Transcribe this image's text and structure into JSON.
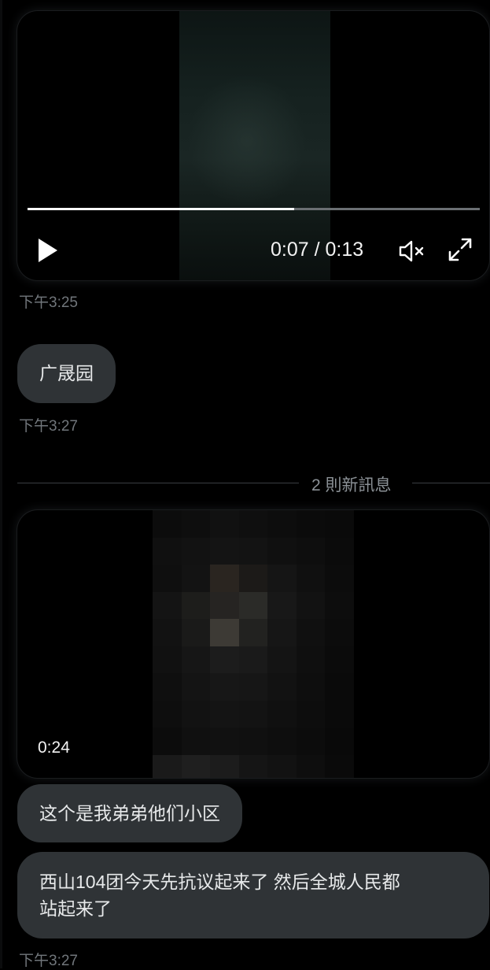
{
  "colors": {
    "background": "#000000",
    "bubble": "#2f3336",
    "text": "#e7e9ea",
    "muted": "#71767b",
    "progress_fill": "#ffffff",
    "progress_track": "#6b6f73"
  },
  "video_1": {
    "progress": 0.59,
    "time_readout": "0:07 / 0:13",
    "icons": [
      "play-icon",
      "volume-muted-icon",
      "fullscreen-icon"
    ]
  },
  "messages": {
    "timestamp_1": "下午3:25",
    "bubble_1": "广晟园",
    "timestamp_2": "下午3:27",
    "new_messages_label": "2 則新訊息",
    "video_2_duration": "0:24",
    "bubble_2": "这个是我弟弟他们小区",
    "bubble_3_line_1": "西山104团今天先抗议起来了 然后全城人民都",
    "bubble_3_line_2": "站起来了",
    "timestamp_3": "下午3:27"
  }
}
